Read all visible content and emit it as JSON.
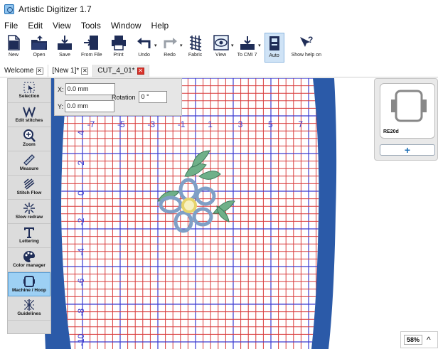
{
  "app": {
    "title": "Artistic Digitizer 1.7"
  },
  "menu": [
    "File",
    "Edit",
    "View",
    "Tools",
    "Window",
    "Help"
  ],
  "toolbar": [
    {
      "label": "New",
      "icon": "new-file-icon"
    },
    {
      "label": "Open",
      "icon": "open-folder-icon"
    },
    {
      "label": "Save",
      "icon": "save-icon"
    },
    {
      "label": "From File",
      "icon": "from-file-icon"
    },
    {
      "label": "Print",
      "icon": "printer-icon"
    },
    {
      "label": "Undo",
      "icon": "undo-icon"
    },
    {
      "label": "Redo",
      "icon": "redo-icon"
    },
    {
      "label": "Fabric",
      "icon": "fabric-icon"
    },
    {
      "label": "View",
      "icon": "eye-icon"
    },
    {
      "label": "To CMI 7",
      "icon": "export-icon"
    },
    {
      "label": "Auto",
      "icon": "auto-icon"
    },
    {
      "label": "Show help on",
      "icon": "help-icon"
    }
  ],
  "tabs": [
    {
      "label": "Welcome",
      "active": false
    },
    {
      "label": "[New 1]*",
      "active": false
    },
    {
      "label": "CUT_4_01*",
      "active": true
    }
  ],
  "tools": [
    {
      "label": "Selection",
      "icon": "selection-icon"
    },
    {
      "label": "Edit stitches",
      "icon": "edit-stitches-icon"
    },
    {
      "label": "Zoom",
      "icon": "zoom-icon"
    },
    {
      "label": "Measure",
      "icon": "measure-icon"
    },
    {
      "label": "Stitch Flow",
      "icon": "stitch-flow-icon"
    },
    {
      "label": "Slow redraw",
      "icon": "slow-redraw-icon"
    },
    {
      "label": "Lettering",
      "icon": "lettering-icon"
    },
    {
      "label": "Color manager",
      "icon": "color-manager-icon"
    },
    {
      "label": "Machine / Hoop",
      "icon": "machine-hoop-icon"
    },
    {
      "label": "Guidelines",
      "icon": "guidelines-icon"
    }
  ],
  "coords": {
    "x_label": "X:",
    "x_value": "0.0 mm",
    "y_label": "Y:",
    "y_value": "0.0 mm",
    "rotation_label": "Rotation",
    "rotation_value": "0 °"
  },
  "hoop": {
    "name": "RE20d",
    "add_label": "+"
  },
  "zoom": {
    "value": "58%"
  },
  "ruler": {
    "x_labels": [
      "-7",
      "-5",
      "-3",
      "-1",
      "1",
      "3",
      "5",
      "7"
    ],
    "y_labels": [
      "4",
      "2",
      "0",
      "-2",
      "-4",
      "-6",
      "-8",
      "-10"
    ]
  },
  "colors": {
    "grid_red": "#d83b3b",
    "grid_blue": "#3a3ad0",
    "hoop_blue": "#2b5aa8",
    "petal_blue": "#7f9fc6",
    "leaf_green": "#6fb089",
    "center_yellow": "#e6d36b",
    "accent": "#1f6fb5"
  }
}
